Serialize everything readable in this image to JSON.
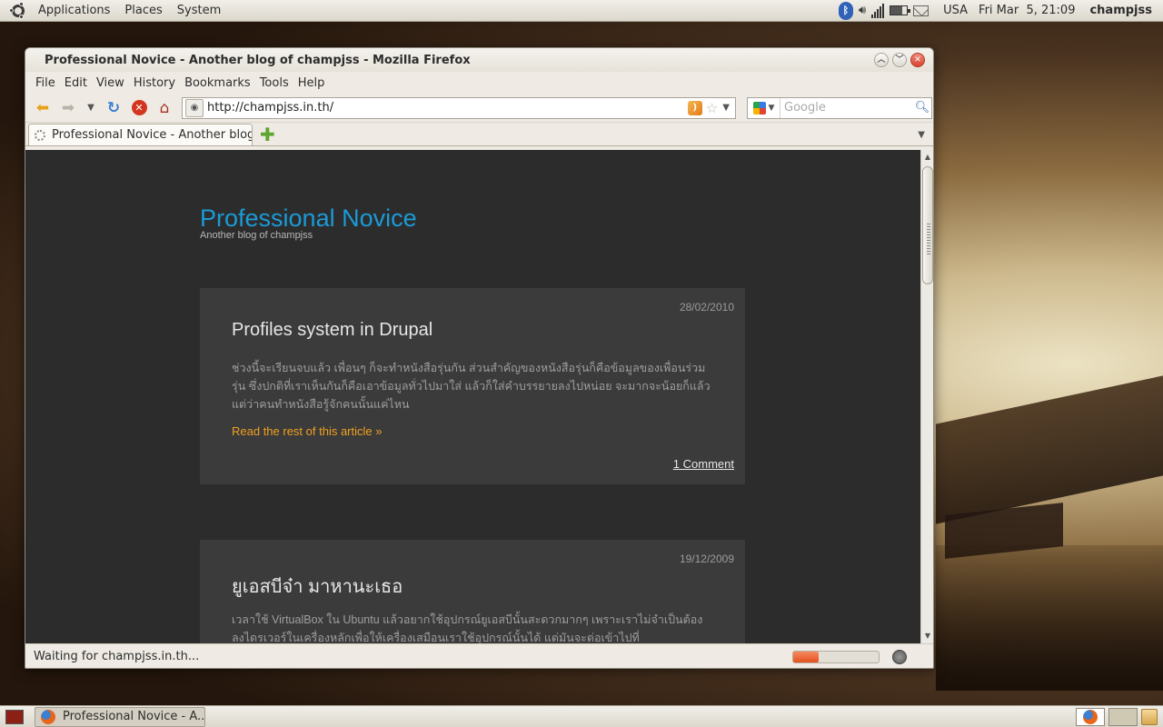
{
  "top_panel": {
    "menus": [
      "Applications",
      "Places",
      "System"
    ],
    "keyboard": "USA",
    "datetime": "Fri Mar  5, 21:09",
    "user": "champjss"
  },
  "window": {
    "title": "Professional Novice - Another blog of champjss - Mozilla Firefox",
    "menus": [
      "File",
      "Edit",
      "View",
      "History",
      "Bookmarks",
      "Tools",
      "Help"
    ],
    "url": "http://champjss.in.th/",
    "search_placeholder": "Google",
    "tab_title": "Professional Novice - Another blog...",
    "status_text": "Waiting for champjss.in.th...",
    "progress": 0.3
  },
  "blog": {
    "title": "Professional Novice",
    "subtitle": "Another blog of champjss",
    "posts": [
      {
        "date": "28/02/2010",
        "title": "Profiles system in Drupal",
        "body": "ช่วงนี้จะเรียนจบแล้ว เพื่อนๆ ก็จะทำหนังสือรุ่นกัน ส่วนสำคัญของหนังสือรุ่นก็คือข้อมูลของเพื่อนร่วมรุ่น ซึ่งปกติที่เราเห็นกันก็คือเอาข้อมูลทั่วไปมาใส่ แล้วก็ใส่คำบรรยายลงไปหน่อย จะมากจะน้อยก็แล้วแต่ว่าคนทำหนังสือรู้จักคนนั้นแค่ไหน",
        "read_more": "Read the rest of this article »",
        "comments": "1 Comment"
      },
      {
        "date": "19/12/2009",
        "title": "ยูเอสบีจ๋า มาหานะเธอ",
        "body": "เวลาใช้ VirtualBox ใน Ubuntu แล้วอยากใช้อุปกรณ์ยูเอสบีนั้นสะดวกมากๆ เพราะเราไม่จำเป็นต้องลงไดรเวอร์ในเครื่องหลักเพื่อให้เครื่องเสมือนเราใช้อุปกรณ์นั้นได้ แต่มันจะต่อเข้าไปที่"
      }
    ]
  },
  "taskbar": {
    "task": "Professional Novice - A..."
  }
}
